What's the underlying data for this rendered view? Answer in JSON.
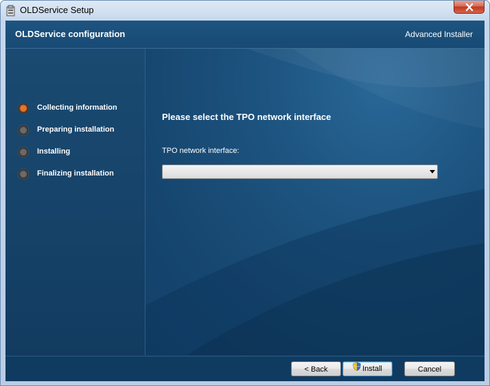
{
  "window": {
    "title": "OLDService Setup"
  },
  "header": {
    "title": "OLDService configuration",
    "brand": "Advanced Installer"
  },
  "steps": [
    {
      "label": "Collecting information",
      "state": "active"
    },
    {
      "label": "Preparing installation",
      "state": "pending"
    },
    {
      "label": "Installing",
      "state": "pending"
    },
    {
      "label": "Finalizing installation",
      "state": "pending"
    }
  ],
  "main": {
    "heading": "Please select the TPO network interface",
    "field_label": "TPO network interface:",
    "combo_value": ""
  },
  "buttons": {
    "back": "< Back",
    "install": "Install",
    "cancel": "Cancel"
  },
  "icons": {
    "close": "close-icon",
    "app": "installer-app-icon",
    "install_shield": "uac-shield-icon"
  },
  "colors": {
    "panel_bg": "#164770",
    "active_step": "#e0782e",
    "close_button": "#c0381f"
  }
}
